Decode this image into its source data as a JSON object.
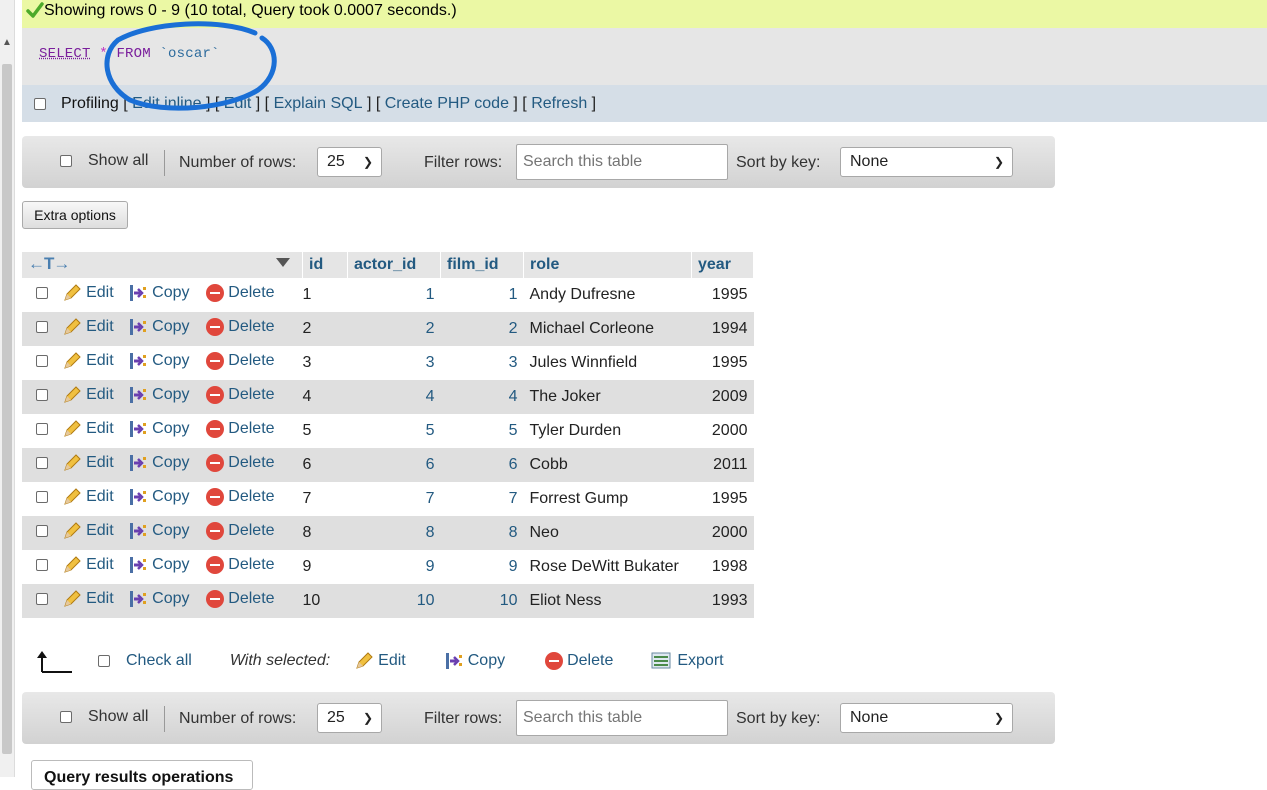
{
  "success": {
    "message": "Showing rows 0 - 9 (10 total, Query took 0.0007 seconds.)",
    "icon": "check-icon"
  },
  "sql": {
    "select": "SELECT",
    "star": "*",
    "from": "FROM",
    "table": "`oscar`"
  },
  "profiling": {
    "label": "Profiling",
    "links": [
      "Edit inline",
      "Edit",
      "Explain SQL",
      "Create PHP code",
      "Refresh"
    ]
  },
  "nav": {
    "show_all": "Show all",
    "num_rows_label": "Number of rows:",
    "num_rows_value": "25",
    "filter_label": "Filter rows:",
    "filter_placeholder": "Search this table",
    "sort_label": "Sort by key:",
    "sort_value": "None"
  },
  "extra_options": "Extra options",
  "table": {
    "headers": [
      "id",
      "actor_id",
      "film_id",
      "role",
      "year"
    ],
    "actions": {
      "edit": "Edit",
      "copy": "Copy",
      "delete": "Delete"
    },
    "rows": [
      {
        "id": "1",
        "actor_id": "1",
        "film_id": "1",
        "role": "Andy Dufresne",
        "year": "1995"
      },
      {
        "id": "2",
        "actor_id": "2",
        "film_id": "2",
        "role": "Michael Corleone",
        "year": "1994"
      },
      {
        "id": "3",
        "actor_id": "3",
        "film_id": "3",
        "role": "Jules Winnfield",
        "year": "1995"
      },
      {
        "id": "4",
        "actor_id": "4",
        "film_id": "4",
        "role": "The Joker",
        "year": "2009"
      },
      {
        "id": "5",
        "actor_id": "5",
        "film_id": "5",
        "role": "Tyler Durden",
        "year": "2000"
      },
      {
        "id": "6",
        "actor_id": "6",
        "film_id": "6",
        "role": "Cobb",
        "year": "2011"
      },
      {
        "id": "7",
        "actor_id": "7",
        "film_id": "7",
        "role": "Forrest Gump",
        "year": "1995"
      },
      {
        "id": "8",
        "actor_id": "8",
        "film_id": "8",
        "role": "Neo",
        "year": "2000"
      },
      {
        "id": "9",
        "actor_id": "9",
        "film_id": "9",
        "role": "Rose DeWitt Bukater",
        "year": "1998"
      },
      {
        "id": "10",
        "actor_id": "10",
        "film_id": "10",
        "role": "Eliot Ness",
        "year": "1993"
      }
    ]
  },
  "bottom": {
    "check_all": "Check all",
    "with_selected": "With selected:",
    "edit": "Edit",
    "copy": "Copy",
    "delete": "Delete",
    "export": "Export"
  },
  "ops_tab": "Query results operations",
  "colors": {
    "link": "#235a81",
    "success_bg": "#ebf8a4",
    "annotation": "#1a6fd6"
  }
}
